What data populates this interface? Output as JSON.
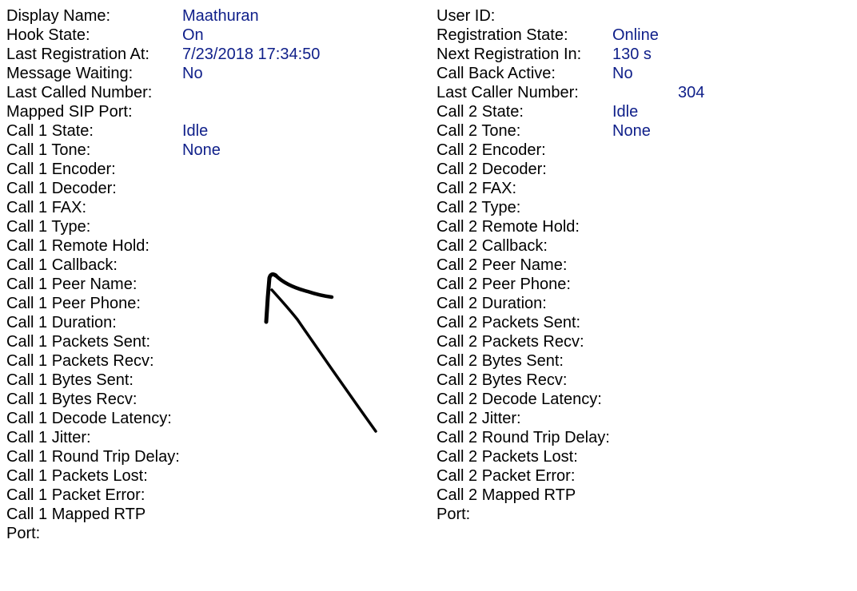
{
  "line1": {
    "rows": [
      {
        "label": "Display Name:",
        "value": "Maathuran"
      },
      {
        "label": "Hook State:",
        "value": "On"
      },
      {
        "label": "Last Registration At:",
        "value": "7/23/2018 17:34:50"
      },
      {
        "label": "Message Waiting:",
        "value": "No"
      },
      {
        "label": "Last Called Number:",
        "value": ""
      },
      {
        "label": "Mapped SIP Port:",
        "value": ""
      },
      {
        "label": "Call 1 State:",
        "value": "Idle"
      },
      {
        "label": "Call 1 Tone:",
        "value": "None"
      },
      {
        "label": "Call 1 Encoder:",
        "value": ""
      },
      {
        "label": "Call 1 Decoder:",
        "value": ""
      },
      {
        "label": "Call 1 FAX:",
        "value": ""
      },
      {
        "label": "Call 1 Type:",
        "value": ""
      },
      {
        "label": "Call 1 Remote Hold:",
        "value": ""
      },
      {
        "label": "Call 1 Callback:",
        "value": ""
      },
      {
        "label": "Call 1 Peer Name:",
        "value": ""
      },
      {
        "label": "Call 1 Peer Phone:",
        "value": ""
      },
      {
        "label": "Call 1 Duration:",
        "value": ""
      },
      {
        "label": "Call 1 Packets Sent:",
        "value": ""
      },
      {
        "label": "Call 1 Packets Recv:",
        "value": ""
      },
      {
        "label": "Call 1 Bytes Sent:",
        "value": ""
      },
      {
        "label": "Call 1 Bytes Recv:",
        "value": ""
      },
      {
        "label": "Call 1 Decode Latency:",
        "value": ""
      },
      {
        "label": "Call 1 Jitter:",
        "value": ""
      },
      {
        "label": "Call 1 Round Trip Delay:",
        "value": ""
      },
      {
        "label": "Call 1 Packets Lost:",
        "value": ""
      },
      {
        "label": "Call 1 Packet Error:",
        "value": ""
      },
      {
        "label": "Call 1 Mapped RTP Port:",
        "value": ""
      }
    ]
  },
  "line2": {
    "rows": [
      {
        "label": "User ID:",
        "value": ""
      },
      {
        "label": "Registration State:",
        "value": "Online"
      },
      {
        "label": "Next Registration In:",
        "value": "130 s"
      },
      {
        "label": "Call Back Active:",
        "value": "No"
      },
      {
        "label": "Last Caller Number:",
        "value": "304"
      },
      {
        "label": "",
        "value": ""
      },
      {
        "label": "Call 2 State:",
        "value": "Idle"
      },
      {
        "label": "Call 2 Tone:",
        "value": "None"
      },
      {
        "label": "Call 2 Encoder:",
        "value": ""
      },
      {
        "label": "Call 2 Decoder:",
        "value": ""
      },
      {
        "label": "Call 2 FAX:",
        "value": ""
      },
      {
        "label": "Call 2 Type:",
        "value": ""
      },
      {
        "label": "Call 2 Remote Hold:",
        "value": ""
      },
      {
        "label": "Call 2 Callback:",
        "value": ""
      },
      {
        "label": "Call 2 Peer Name:",
        "value": ""
      },
      {
        "label": "Call 2 Peer Phone:",
        "value": ""
      },
      {
        "label": "Call 2 Duration:",
        "value": ""
      },
      {
        "label": "Call 2 Packets Sent:",
        "value": ""
      },
      {
        "label": "Call 2 Packets Recv:",
        "value": ""
      },
      {
        "label": "Call 2 Bytes Sent:",
        "value": ""
      },
      {
        "label": "Call 2 Bytes Recv:",
        "value": ""
      },
      {
        "label": "Call 2 Decode Latency:",
        "value": ""
      },
      {
        "label": "Call 2 Jitter:",
        "value": ""
      },
      {
        "label": "Call 2 Round Trip Delay:",
        "value": ""
      },
      {
        "label": "Call 2 Packets Lost:",
        "value": ""
      },
      {
        "label": "Call 2 Packet Error:",
        "value": ""
      },
      {
        "label": "Call 2 Mapped RTP Port:",
        "value": ""
      }
    ]
  },
  "annotation": {
    "icon": "hand-drawn-arrow-icon",
    "color": "#000000"
  },
  "colors": {
    "value_text": "#10208a",
    "label_text": "#000000"
  }
}
